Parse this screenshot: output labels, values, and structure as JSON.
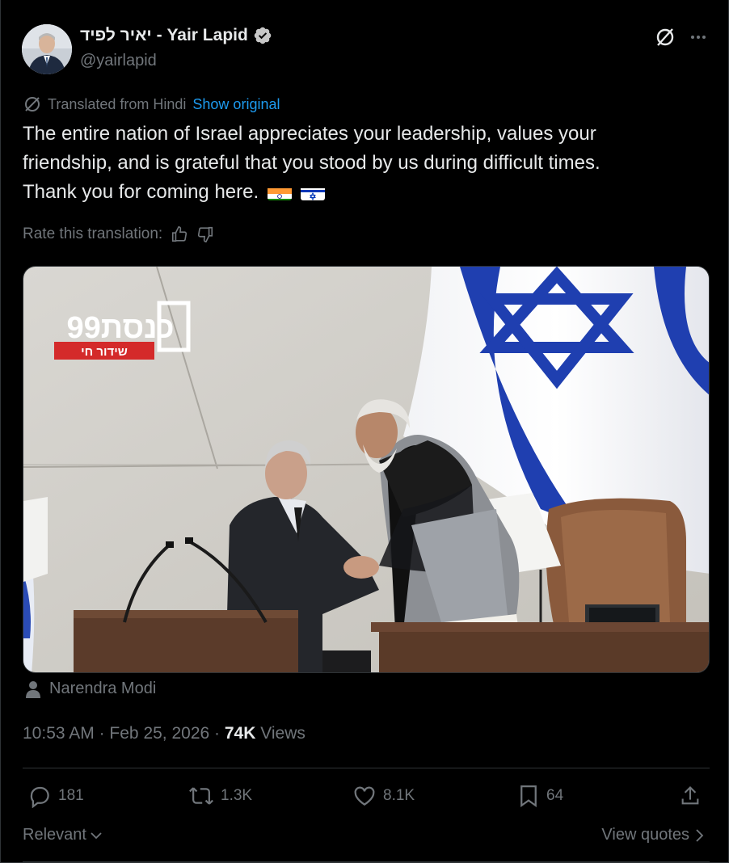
{
  "author": {
    "display_name": "יאיר לפיד - Yair Lapid",
    "handle": "@yairlapid"
  },
  "translation": {
    "label": "Translated from Hindi",
    "show_original": "Show original",
    "rate_label": "Rate this translation:"
  },
  "tweet": {
    "lines": [
      "The entire nation of Israel appreciates your leadership, values your",
      "friendship, and is grateful that you stood by us during difficult times.",
      "Thank you for coming here."
    ]
  },
  "media": {
    "channel_logo": "כנסת99",
    "live_banner": "שידור חי",
    "tagged_person": "Narendra Modi"
  },
  "meta": {
    "time": "10:53 AM",
    "date": "Feb 25, 2026",
    "views_count": "74K",
    "views_label": "Views",
    "separator": "·"
  },
  "actions": {
    "replies": "181",
    "reposts": "1.3K",
    "likes": "8.1K",
    "bookmarks": "64"
  },
  "footer": {
    "sort_label": "Relevant",
    "view_quotes": "View quotes"
  },
  "colors": {
    "background": "#000000",
    "text": "#e7e9ea",
    "muted": "#71767b",
    "link": "#1d9bf0",
    "divider": "#2f3336"
  },
  "icons": [
    "verified-badge-icon",
    "grok-icon",
    "more-icon",
    "translate-icon",
    "thumbs-up-icon",
    "thumbs-down-icon",
    "person-icon",
    "reply-icon",
    "repost-icon",
    "like-icon",
    "bookmark-icon",
    "share-icon",
    "chevron-down-icon",
    "chevron-right-icon",
    "india-flag-icon",
    "israel-flag-icon"
  ]
}
